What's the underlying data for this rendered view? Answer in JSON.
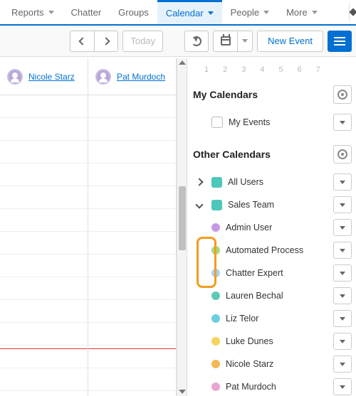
{
  "tabs": [
    {
      "label": "Reports",
      "hasChevron": true
    },
    {
      "label": "Chatter",
      "hasChevron": false
    },
    {
      "label": "Groups",
      "hasChevron": false
    },
    {
      "label": "Calendar",
      "hasChevron": true,
      "active": true
    },
    {
      "label": "People",
      "hasChevron": true
    },
    {
      "label": "More",
      "hasChevron": true
    }
  ],
  "toolbar": {
    "today": "Today",
    "newEvent": "New Event"
  },
  "columns": [
    {
      "name": "Nicole Starz"
    },
    {
      "name": "Pat Murdoch"
    }
  ],
  "dayNumbers": [
    "1",
    "2",
    "3",
    "4",
    "5",
    "6",
    "7"
  ],
  "sections": {
    "myCalendars": "My Calendars",
    "otherCalendars": "Other Calendars"
  },
  "myEvents": {
    "label": "My Events"
  },
  "otherGroups": [
    {
      "label": "All Users",
      "color": "#4bc8b9",
      "expanded": false
    },
    {
      "label": "Sales Team",
      "color": "#4bc8b9",
      "expanded": true
    }
  ],
  "members": [
    {
      "label": "Admin User",
      "color": "#c49ae8"
    },
    {
      "label": "Automated Process",
      "color": "#a7d97a"
    },
    {
      "label": "Chatter Expert",
      "color": "#a7d2f5"
    },
    {
      "label": "Lauren Bechal",
      "color": "#5ecab5"
    },
    {
      "label": "Liz Telor",
      "color": "#69d0e0"
    },
    {
      "label": "Luke Dunes",
      "color": "#f6d35a"
    },
    {
      "label": "Nicole Starz",
      "color": "#f3b957"
    },
    {
      "label": "Pat Murdoch",
      "color": "#e9a6d3"
    }
  ]
}
